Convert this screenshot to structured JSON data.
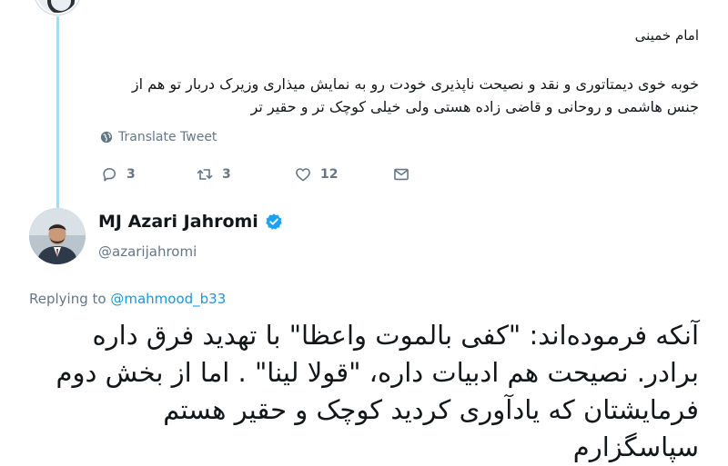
{
  "tweet1": {
    "author_line": "امام خمینی",
    "body": "خوبه خوی دیمتاتوری و نقد و نصیحت ناپذیری خودت رو به نمایش میذاری وزیرک دربار تو هم از جنس هاشمی و روحانی و قاضی زاده هستی ولی خیلی کوچک تر و حقیر تر",
    "translate_label": "Translate Tweet",
    "replies": "3",
    "retweets": "3",
    "likes": "12"
  },
  "tweet2": {
    "name": "MJ Azari Jahromi",
    "handle": "@azarijahromi",
    "replying_prefix": "Replying to",
    "replying_mention": "@mahmood_b33",
    "text": "آنکه فرموده‌اند: \"کفی بالموت واعظا\" با تهدید فرق داره برادر. نصیحت هم ادبیات داره، \"قولا لینا\" . اما از بخش دوم فرمایشتان که یادآوری کردید کوچک و حقیر هستم سپاسگزارم"
  },
  "colors": {
    "accent": "#1da1f2",
    "link": "#1b95e0",
    "muted": "#657786",
    "thread_line": "#a7dbf5",
    "text": "#14171a"
  },
  "icons": [
    "globe-icon",
    "reply-icon",
    "retweet-icon",
    "like-icon",
    "direct-message-icon",
    "verified-badge-icon"
  ]
}
